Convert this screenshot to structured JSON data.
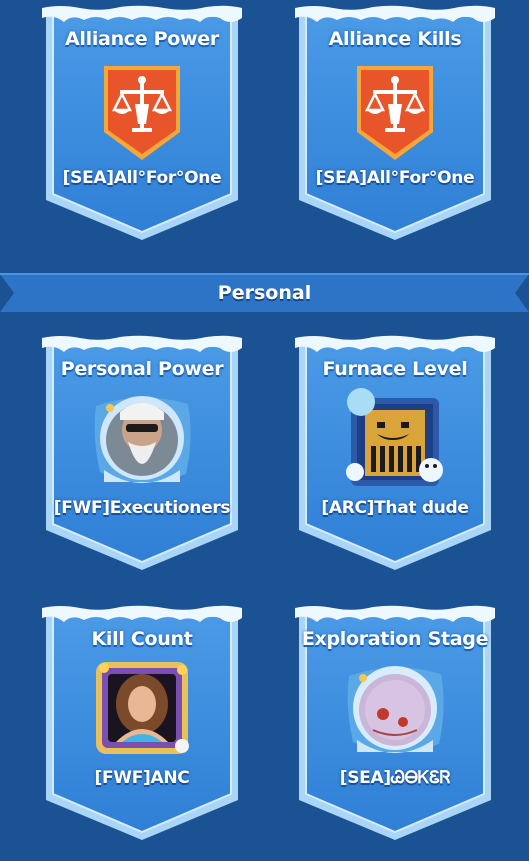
{
  "colors": {
    "background": "#1a5294",
    "card_fill": "#3b8ee0",
    "card_border": "#9fd0f7",
    "banner": "#2d74c6",
    "emblem": "#e8552a",
    "emblem_rim": "#f7a63a"
  },
  "alliance_cards": [
    {
      "title": "Alliance Power",
      "name": "[SEA]All°For°One",
      "icon": "alliance-scales-emblem"
    },
    {
      "title": "Alliance Kills",
      "name": "[SEA]All°For°One",
      "icon": "alliance-scales-emblem"
    }
  ],
  "section": {
    "label": "Personal"
  },
  "personal_cards": [
    {
      "title": "Personal Power",
      "name": "[FWF]Executioners",
      "icon": "player-avatar"
    },
    {
      "title": "Furnace Level",
      "name": "[ARC]That dude",
      "icon": "player-avatar"
    },
    {
      "title": "Kill Count",
      "name": "[FWF]ANC",
      "icon": "player-avatar"
    },
    {
      "title": "Exploration Stage",
      "name": "[SEA]ᏊᎾᏦᏋᏒ",
      "icon": "player-avatar"
    }
  ]
}
